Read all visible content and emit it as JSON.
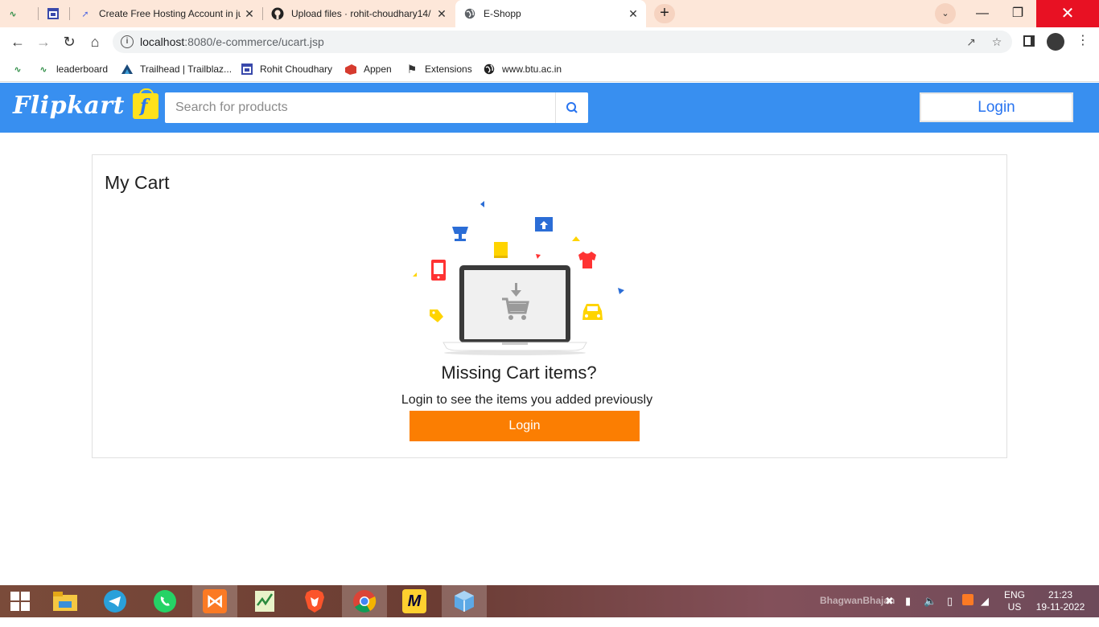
{
  "browser": {
    "tabs": [
      {
        "title": "",
        "icon": "gfg-icon"
      },
      {
        "title": "",
        "icon": "calendar-icon"
      },
      {
        "title": "Create Free Hosting Account in ju",
        "icon": "rocket-icon"
      },
      {
        "title": "Upload files · rohit-choudhary14/",
        "icon": "github-icon"
      },
      {
        "title": "E-Shopp",
        "icon": "globe-icon",
        "active": true
      }
    ],
    "address": {
      "host": "localhost",
      "path": ":8080/e-commerce/ucart.jsp"
    },
    "bookmarks": [
      {
        "label": "",
        "icon": "gfg-icon"
      },
      {
        "label": "leaderboard",
        "icon": "gfg-icon"
      },
      {
        "label": "Trailhead | Trailblaz...",
        "icon": "trailhead-icon"
      },
      {
        "label": "Rohit Choudhary",
        "icon": "calendar-icon"
      },
      {
        "label": "Appen",
        "icon": "appen-icon"
      },
      {
        "label": "Extensions",
        "icon": "puzzle-icon"
      },
      {
        "label": "www.btu.ac.in",
        "icon": "globe-icon"
      }
    ]
  },
  "site": {
    "logo_text": "Flipkart",
    "search_placeholder": "Search for products",
    "header_login": "Login",
    "brand_color": "#388ff0"
  },
  "cart": {
    "title": "My Cart",
    "empty_heading": "Missing Cart items?",
    "empty_sub": "Login to see the items you added previously",
    "login_button": "Login",
    "button_color": "#fb7e02"
  },
  "taskbar": {
    "lang_line1": "ENG",
    "lang_line2": "US",
    "time": "21:23",
    "date": "19-11-2022",
    "wallpaper_text": "BhagwanBhajan"
  }
}
